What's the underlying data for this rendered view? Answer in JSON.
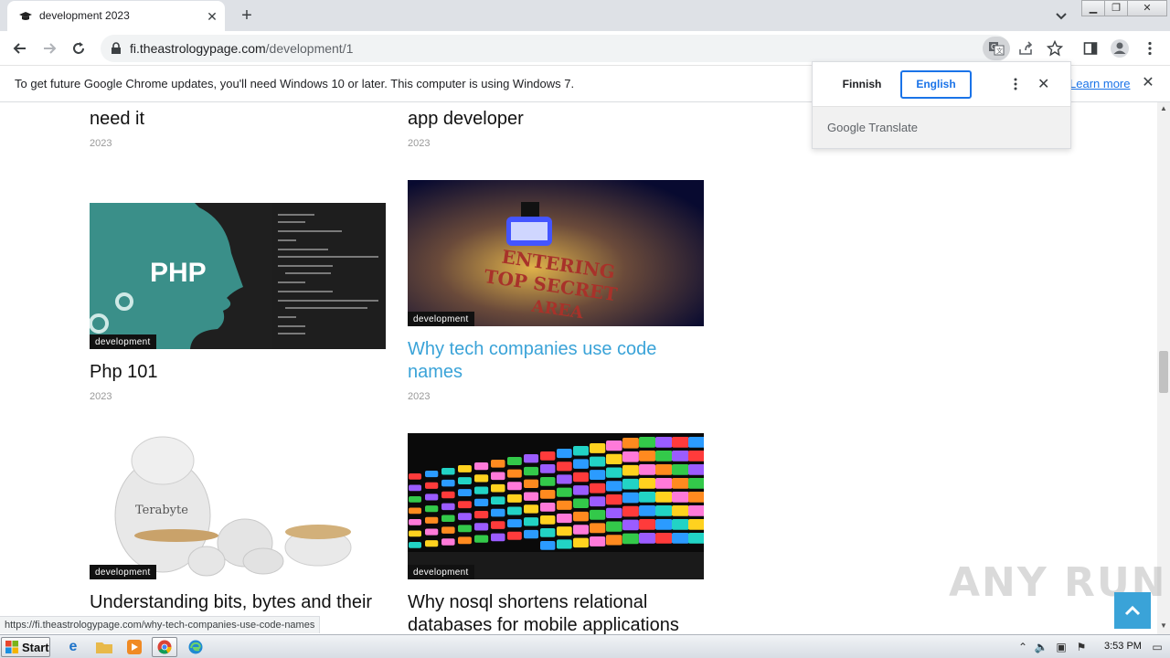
{
  "browser": {
    "tab_title": "development 2023",
    "url_host": "fi.theastrologypage.com",
    "url_path": "/development/1",
    "icons": [
      "favicon-graduation-cap",
      "close-icon",
      "plus-icon",
      "chevron-down-icon",
      "back-icon",
      "forward-icon",
      "reload-icon",
      "lock-icon",
      "translate-icon",
      "share-icon",
      "star-icon",
      "side-panel-icon",
      "profile-icon",
      "menu-icon"
    ]
  },
  "infobar": {
    "text": "To get future Google Chrome updates, you'll need Windows 10 or later. This computer is using Windows 7.",
    "learn_more": "Learn more"
  },
  "translate_popup": {
    "source_lang": "Finnish",
    "target_lang": "English",
    "brand": "Google Translate"
  },
  "posts": [
    {
      "title": "need it",
      "date": "2023"
    },
    {
      "title": "app developer",
      "date": "2023"
    },
    {
      "title": "Php 101",
      "date": "2023",
      "category": "development",
      "image_text": "PHP"
    },
    {
      "title": "Why tech companies use code names",
      "date": "2023",
      "category": "development",
      "image_text_line1": "ENTERING",
      "image_text_line2": "TOP SECRET",
      "image_text_line3": "AREA"
    },
    {
      "title": "Understanding bits, bytes and their",
      "category": "development",
      "image_text": "Terabyte"
    },
    {
      "title": "Why nosql shortens relational databases for mobile applications",
      "category": "development"
    }
  ],
  "status_url": "https://fi.theastrologypage.com/why-tech-companies-use-code-names",
  "watermark": "ANY RUN",
  "taskbar": {
    "start_label": "Start",
    "clock": "3:53 PM"
  },
  "colors": {
    "link": "#3aa3d8",
    "accent": "#1a73e8",
    "badge": "#111111"
  }
}
